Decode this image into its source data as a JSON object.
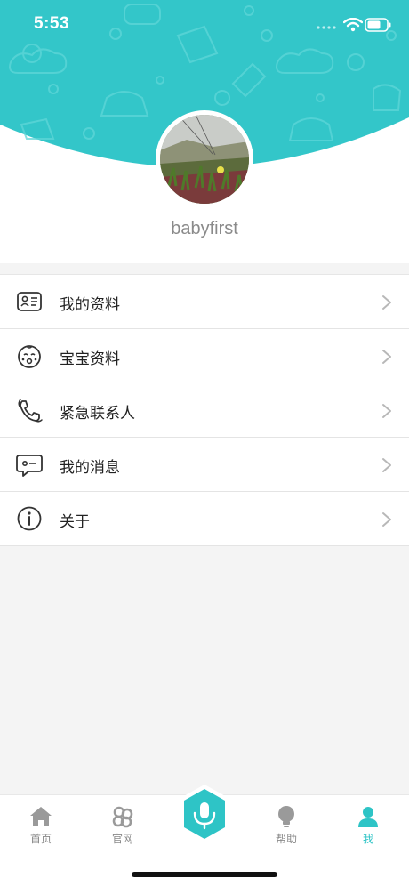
{
  "status_bar": {
    "time": "5:53",
    "icons": [
      "wifi-icon",
      "battery-icon"
    ]
  },
  "profile": {
    "username": "babyfirst",
    "avatar": "avatar-photo"
  },
  "menu": [
    {
      "label": "我的资料",
      "icon": "id-card-icon"
    },
    {
      "label": "宝宝资料",
      "icon": "baby-face-icon"
    },
    {
      "label": "紧急联系人",
      "icon": "phone-call-icon"
    },
    {
      "label": "我的消息",
      "icon": "message-icon"
    },
    {
      "label": "关于",
      "icon": "info-icon"
    }
  ],
  "tabbar": {
    "tabs": [
      {
        "label": "首页",
        "icon": "home-icon",
        "active": false
      },
      {
        "label": "官网",
        "icon": "website-icon",
        "active": false
      },
      {
        "label": "帮助",
        "icon": "lightbulb-icon",
        "active": false
      },
      {
        "label": "我",
        "icon": "profile-icon",
        "active": true
      }
    ],
    "center_button_icon": "microphone-icon"
  },
  "colors": {
    "accent": "#2ec4c6",
    "header_bg": "#33c6c9",
    "text_primary": "#222222",
    "text_secondary": "#8a8a8a",
    "page_bg": "#f4f4f4"
  }
}
